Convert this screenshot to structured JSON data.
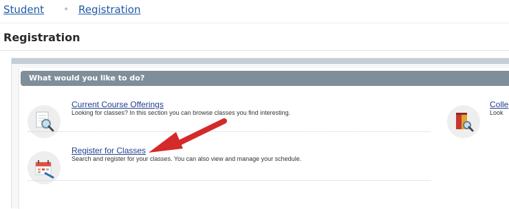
{
  "breadcrumb": {
    "items": [
      "Student",
      "Registration"
    ],
    "separator": "•"
  },
  "page": {
    "title": "Registration"
  },
  "panel": {
    "header": "What would you like to do?"
  },
  "options": [
    {
      "title": "Current Course Offerings",
      "description": "Looking for classes? In this section you can browse classes you find interesting.",
      "icon": "magnifier-document-icon"
    },
    {
      "title": "Register for Classes",
      "description": "Search and register for your classes. You can also view and manage your schedule.",
      "icon": "calendar-pencil-icon"
    },
    {
      "title": "Colle",
      "description": "Look",
      "icon": "book-magnifier-icon"
    }
  ],
  "annotation": {
    "arrow_color": "#d42a2a"
  },
  "colors": {
    "link": "#1f3f8f",
    "header_bar": "#7f8e99",
    "breadcrumb_link": "#1f5aa6"
  }
}
